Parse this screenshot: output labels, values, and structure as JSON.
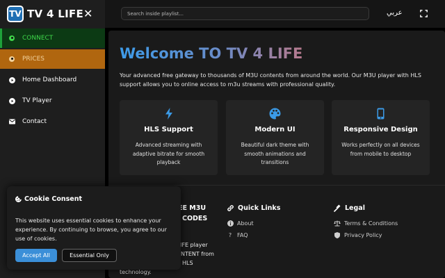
{
  "brand": {
    "logo_text": "TV",
    "name": "TV 4 LIFE"
  },
  "sidebar": {
    "items": [
      {
        "label": "CONNECT",
        "icon": "user-circle-icon"
      },
      {
        "label": "PRICES",
        "icon": "user-circle-icon"
      },
      {
        "label": "Home Dashboard",
        "icon": "play-circle-icon"
      },
      {
        "label": "TV Player",
        "icon": "play-circle-icon"
      },
      {
        "label": "Contact",
        "icon": "envelope-icon"
      }
    ]
  },
  "topbar": {
    "search_placeholder": "Search inside playlist...",
    "language": "عربي"
  },
  "main": {
    "title": "Welcome TO TV 4 LIFE",
    "intro": "Your advanced free gateway to thousands of M3U contents from around the world. Our M3U player with HLS support allows you to online access to m3u streams with professional quality.",
    "features": [
      {
        "title": "HLS Support",
        "desc": "Advanced streaming with adaptive bitrate for smooth playback",
        "icon": "bolt-icon"
      },
      {
        "title": "Modern UI",
        "desc": "Beautiful dark theme with smooth animations and transitions",
        "icon": "palette-icon"
      },
      {
        "title": "Responsive Design",
        "desc": "Works perfectly on all devices from mobile to desktop",
        "icon": "mobile-icon"
      }
    ]
  },
  "footer": {
    "about_title_line1": "EE M3U",
    "about_title_line2": "CODES",
    "about_text_line1": "IFE player",
    "about_text_line2": "NTENT from",
    "about_text_line3": "HLS",
    "about_text_line4": "technology.",
    "quick_links_title": "Quick Links",
    "quick_links": [
      {
        "label": "About",
        "icon": "info-circle-icon"
      },
      {
        "label": "FAQ",
        "icon": "question-icon"
      }
    ],
    "legal_title": "Legal",
    "legal_links": [
      {
        "label": "Terms & Conditions",
        "icon": "scale-icon"
      },
      {
        "label": "Privacy Policy",
        "icon": "shield-icon"
      }
    ]
  },
  "cookie": {
    "title": "Cookie Consent",
    "text": "This website uses essential cookies to enhance your experience. By continuing to browse, you agree to our use of cookies.",
    "accept_label": "Accept All",
    "essential_label": "Essential Only"
  },
  "colors": {
    "accent_blue": "#3b8fd8",
    "connect_green": "#3fd64a",
    "prices_orange": "#b0660f"
  }
}
